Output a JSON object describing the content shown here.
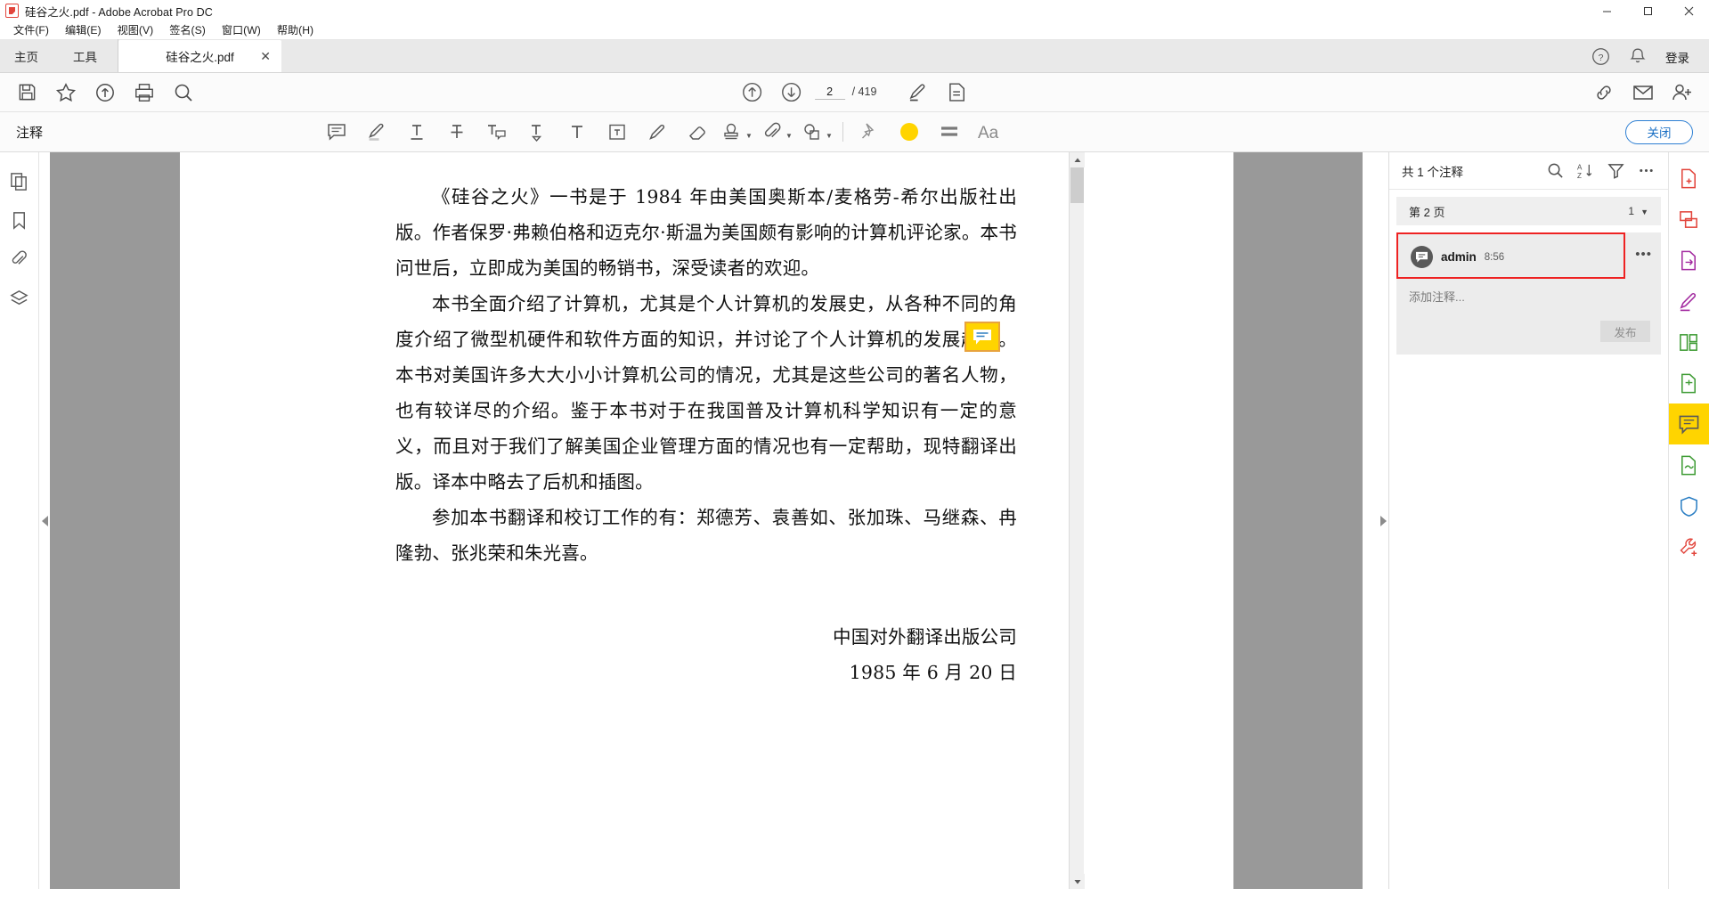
{
  "window": {
    "title": "硅谷之火.pdf - Adobe Acrobat Pro DC",
    "app_icon": "pdf-logo-icon",
    "minimize": "minimize-icon",
    "maximize": "maximize-icon",
    "close": "close-icon"
  },
  "menubar": {
    "items": [
      {
        "label": "文件(F)",
        "name": "menu-file"
      },
      {
        "label": "编辑(E)",
        "name": "menu-edit"
      },
      {
        "label": "视图(V)",
        "name": "menu-view"
      },
      {
        "label": "签名(S)",
        "name": "menu-sign"
      },
      {
        "label": "窗口(W)",
        "name": "menu-window"
      },
      {
        "label": "帮助(H)",
        "name": "menu-help"
      }
    ]
  },
  "tabstrip": {
    "home": "主页",
    "tools": "工具",
    "document_tab": "硅谷之火.pdf",
    "tab_close": "✕",
    "help_icon": "help-circle-icon",
    "bell_icon": "notification-bell-icon",
    "login": "登录"
  },
  "toolbar": {
    "save_icon": "save-disk-icon",
    "star_icon": "star-favorite-icon",
    "upload_icon": "upload-cloud-icon",
    "print_icon": "printer-icon",
    "zoom_icon": "magnifier-icon",
    "prev_page_icon": "arrow-up-circle-icon",
    "next_page_icon": "arrow-down-circle-icon",
    "page_current": "2",
    "page_total": "/ 419",
    "highlight_tool_icon": "highlight-pen-icon",
    "stamp_tool_icon": "stamp-page-icon",
    "link_icon": "link-chain-icon",
    "mail_icon": "envelope-icon",
    "share_icon": "add-person-icon"
  },
  "commentbar": {
    "title": "注释",
    "tools": [
      {
        "name": "sticky-note-icon",
        "label": "添加附注"
      },
      {
        "name": "highlight-text-icon",
        "label": "高亮文本"
      },
      {
        "name": "underline-text-icon",
        "label": "下划线文本"
      },
      {
        "name": "strikethrough-text-icon",
        "label": "删除线文本"
      },
      {
        "name": "replace-text-icon",
        "label": "替换文本注释"
      },
      {
        "name": "insert-text-icon",
        "label": "插入文本"
      },
      {
        "name": "add-text-icon",
        "label": "添加文本注释"
      },
      {
        "name": "text-box-icon",
        "label": "添加文本框"
      },
      {
        "name": "draw-pencil-icon",
        "label": "绘图"
      },
      {
        "name": "eraser-icon",
        "label": "擦除"
      },
      {
        "name": "stamp-icon",
        "label": "图章"
      },
      {
        "name": "attach-clip-icon",
        "label": "附加"
      },
      {
        "name": "shapes-icon",
        "label": "绘图工具"
      },
      {
        "name": "pin-icon",
        "label": "固定"
      }
    ],
    "color_swatch": "#ffd400",
    "color_swatch_name": "color-swatch-yellow",
    "thickness_icon": "line-thickness-icon",
    "font_icon": "font-size-icon",
    "close_label": "关闭"
  },
  "leftrail": {
    "items": [
      {
        "name": "page-thumbnails-icon"
      },
      {
        "name": "bookmarks-icon"
      },
      {
        "name": "attachments-clip-icon"
      },
      {
        "name": "layers-icon"
      }
    ]
  },
  "document": {
    "scroll_up_arrow": "scroll-up-arrow",
    "scroll_down_arrow": "scroll-down-arrow",
    "collapse_left": "collapse-left-arrow",
    "collapse_right": "collapse-right-arrow",
    "note_marker_icon": "sticky-note-marker-icon",
    "paragraphs": [
      "《硅谷之火》一书是于 1984 年由美国奥斯本/麦格劳-希尔出版社出版。作者保罗·弗赖伯格和迈克尔·斯温为美国颇有影响的计算机评论家。本书问世后，立即成为美国的畅销书，深受读者的欢迎。",
      "本书全面介绍了计算机，尤其是个人计算机的发展史，从各种不同的角度介绍了微型机硬件和软件方面的知识，并讨论了个人计算机的发展趋势。本书对美国许多大大小小计算机公司的情况，尤其是这些公司的著名人物，也有较详尽的介绍。鉴于本书对于在我国普及计算机科学知识有一定的意义，而且对于我们了解美国企业管理方面的情况也有一定帮助，现特翻译出版。译本中略去了后机和插图。",
      "参加本书翻译和校订工作的有：郑德芳、袁善如、张加珠、马继森、冉隆勃、张兆荣和朱光喜。"
    ],
    "signature_line1": "中国对外翻译出版公司",
    "signature_line2": "1985 年 6 月 20 日"
  },
  "comments_panel": {
    "header_title": "共 1 个注释",
    "search_icon": "search-icon",
    "sort_icon": "sort-az-icon",
    "filter_icon": "filter-funnel-icon",
    "more_icon": "more-options-icon",
    "page_group_label": "第 2 页",
    "page_group_count": "1",
    "page_group_chevron": "chevron-down-icon",
    "comment": {
      "avatar_icon": "comment-bubble-avatar-icon",
      "author": "admin",
      "time": "8:56",
      "more_icon": "comment-more-icon",
      "reply_placeholder": "添加注释...",
      "post_label": "发布",
      "highlight_color": "#ee2222"
    }
  },
  "rightrail": {
    "items": [
      {
        "name": "create-pdf-icon",
        "color": "#e2453c"
      },
      {
        "name": "combine-files-icon",
        "color": "#e2453c"
      },
      {
        "name": "export-pdf-icon",
        "color": "#a32ba0"
      },
      {
        "name": "edit-pdf-icon",
        "color": "#a32ba0"
      },
      {
        "name": "organize-pages-icon",
        "color": "#3f9c35"
      },
      {
        "name": "compress-pdf-icon",
        "color": "#3f9c35"
      },
      {
        "name": "comment-icon",
        "color": "#6b6b6b",
        "active": true
      },
      {
        "name": "fill-sign-icon",
        "color": "#3f9c35"
      },
      {
        "name": "protect-shield-icon",
        "color": "#2c7fc4"
      },
      {
        "name": "more-tools-icon",
        "color": "#e2453c"
      }
    ]
  }
}
